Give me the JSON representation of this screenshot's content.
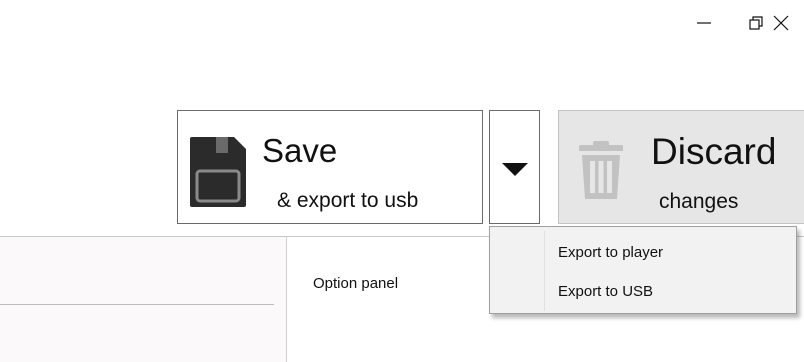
{
  "window_controls": {
    "minimize": "minimize-icon",
    "restore": "restore-icon",
    "close": "close-icon"
  },
  "toolbar": {
    "save_button": {
      "title": "Save",
      "subtitle": "& export to usb",
      "icon": "floppy-disk-icon"
    },
    "dropdown": {
      "icon": "chevron-down-icon"
    },
    "discard_button": {
      "title": "Discard",
      "subtitle": "changes",
      "icon": "trash-icon",
      "state": "disabled"
    }
  },
  "export_menu": {
    "items": [
      {
        "label": "Export to player"
      },
      {
        "label": "Export to USB"
      }
    ]
  },
  "option_panel": {
    "title": "Option panel"
  },
  "colors": {
    "background": "#ffffff",
    "button_border": "#6b6b6b",
    "disabled_button_bg": "#e6e6e6",
    "menu_bg": "#f2f2f2",
    "floppy_icon": "#2b2b2b",
    "trash_icon_disabled": "#c2c2c2"
  }
}
